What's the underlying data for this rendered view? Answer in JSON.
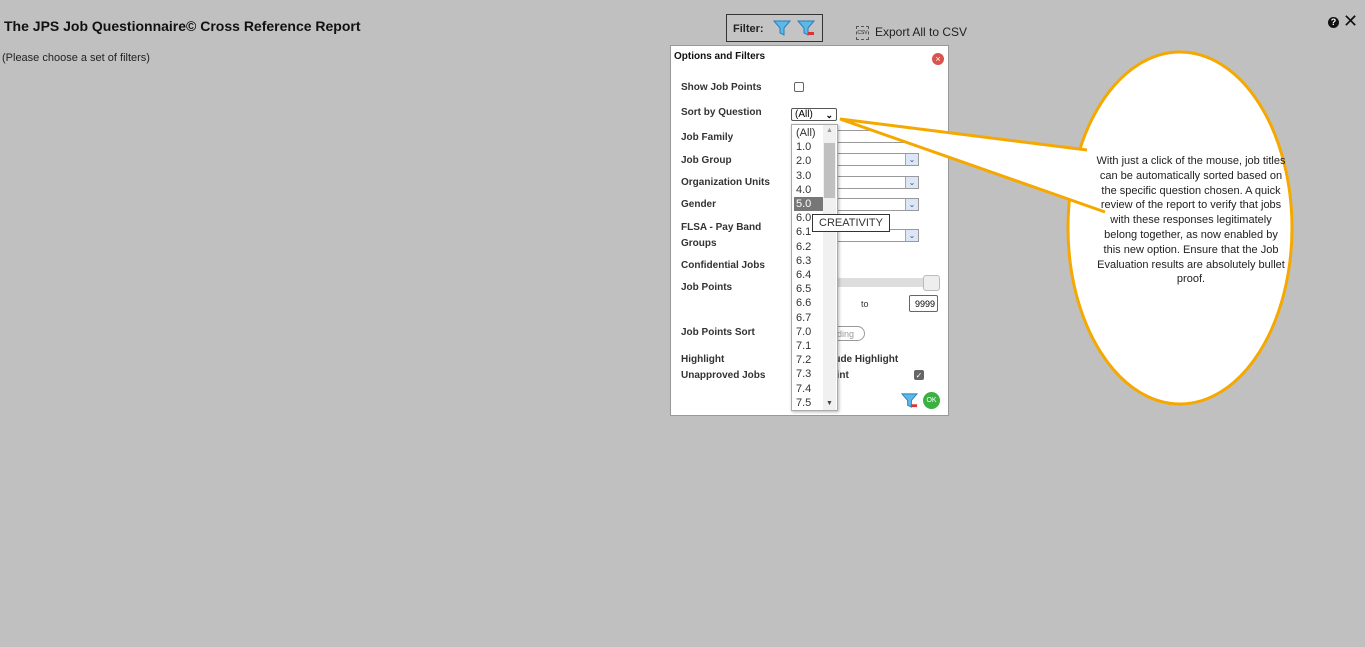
{
  "header": {
    "title": "The JPS Job Questionnaire© Cross Reference Report",
    "hint": "(Please choose a set of filters)",
    "filter_label": "Filter:",
    "export_label": "Export All to CSV",
    "export_icon": "csv-icon"
  },
  "panel": {
    "title": "Options and Filters",
    "labels": {
      "show_job_points": "Show Job Points",
      "sort_by_question": "Sort by Question",
      "job_family": "Job Family",
      "job_group": "Job Group",
      "org_units": "Organization Units",
      "gender": "Gender",
      "flsa": "FLSA - Pay Band Groups",
      "confidential": "Confidential Jobs",
      "job_points": "Job Points",
      "job_points_sort": "Job Points Sort",
      "highlight": "Highlight Unapproved Jobs",
      "include_highlight": "clude Highlight",
      "print": "Print",
      "to": "to",
      "sort_toggle": "ding"
    },
    "sort_value": "(All)",
    "points_max": "9999",
    "show_job_points_checked": false,
    "include_highlight_checked": true
  },
  "dropdown": {
    "options": [
      "(All)",
      "1.0",
      "2.0",
      "3.0",
      "4.0",
      "5.0",
      "6.0",
      "6.1",
      "6.2",
      "6.3",
      "6.4",
      "6.5",
      "6.6",
      "6.7",
      "7.0",
      "7.1",
      "7.2",
      "7.3",
      "7.4",
      "7.5"
    ],
    "highlighted": "5.0",
    "tooltip": "CREATIVITY"
  },
  "callout": {
    "text": "With just a click of the mouse, job titles can be automatically sorted based on the specific question chosen. A quick review of the report to verify that jobs with these responses legitimately belong together, as now enabled by this new option. Ensure that the Job Evaluation results are absolutely bullet proof.",
    "border_color": "#f5a800"
  }
}
